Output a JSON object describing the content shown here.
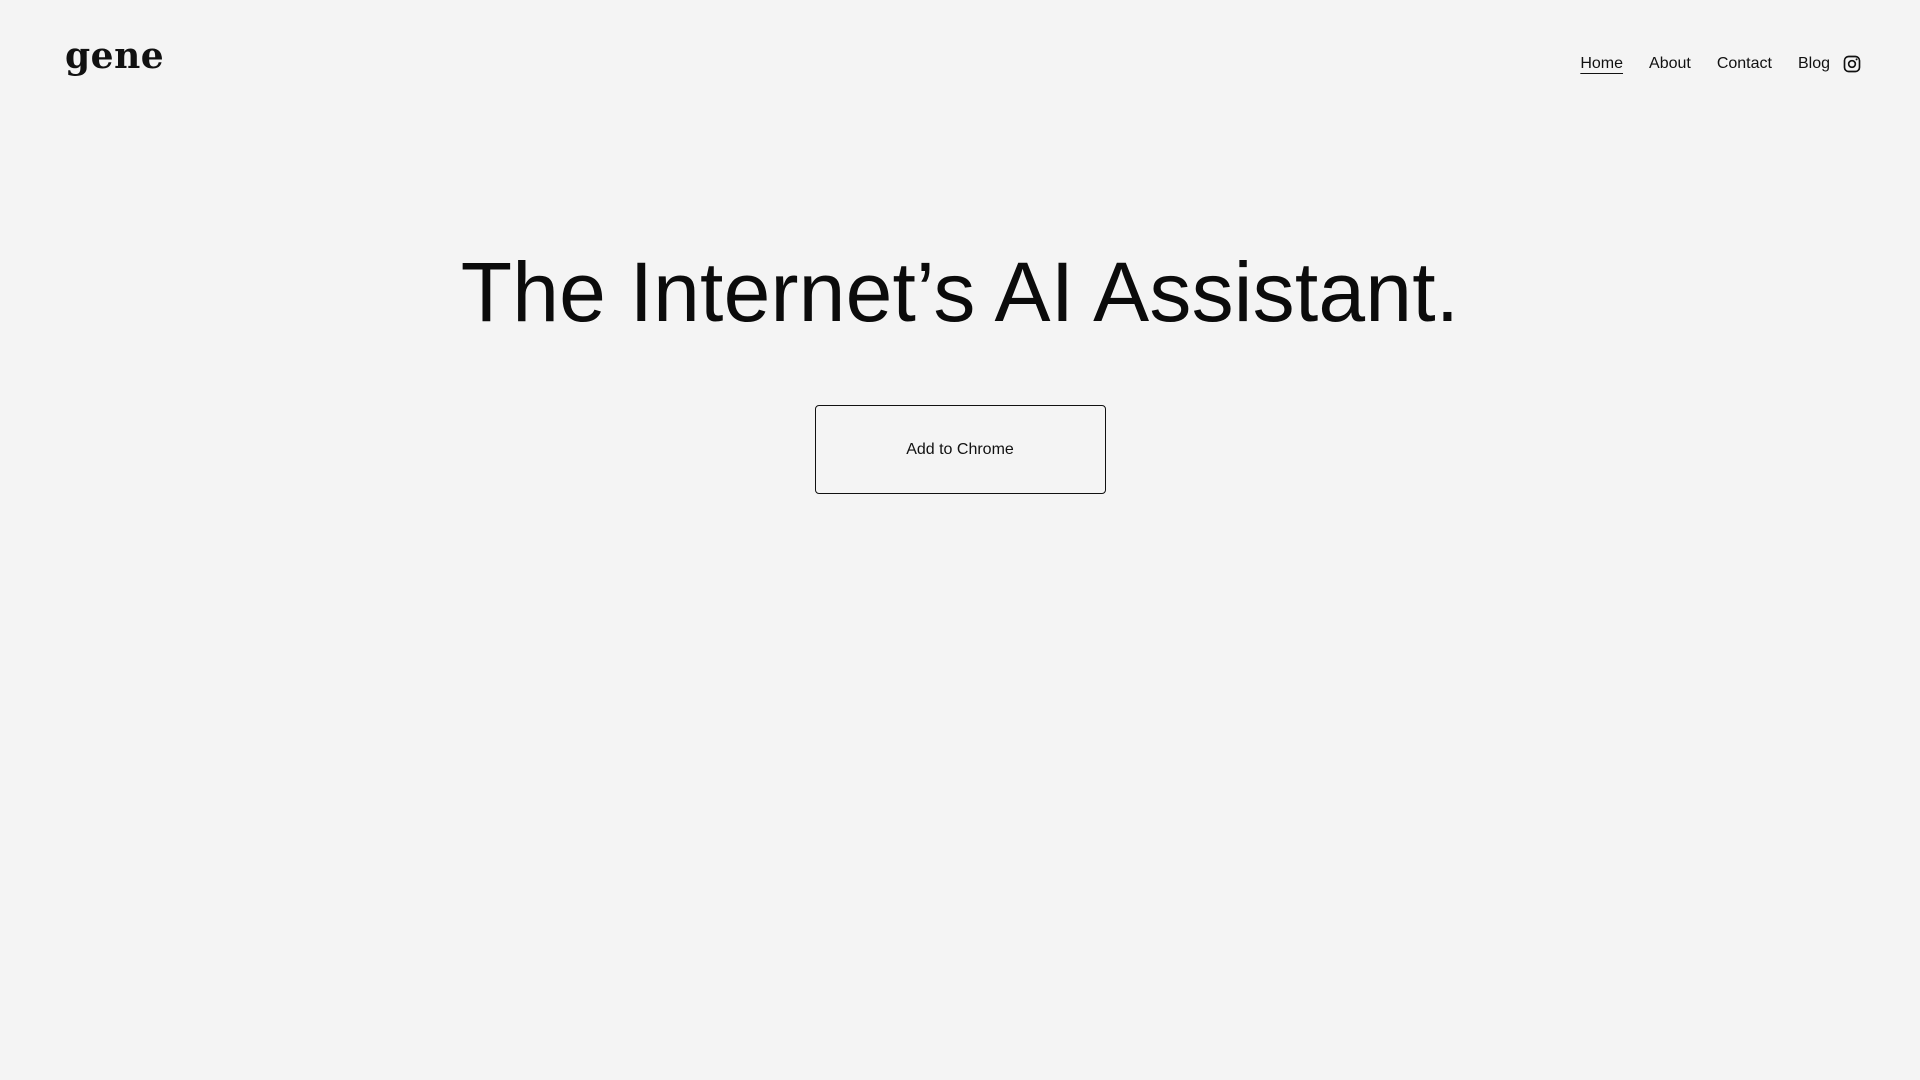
{
  "site": {
    "logo_text": "gene"
  },
  "nav": {
    "items": [
      {
        "label": "Home"
      },
      {
        "label": "About"
      },
      {
        "label": "Contact"
      },
      {
        "label": "Blog"
      }
    ],
    "social_icon": "instagram-icon"
  },
  "hero": {
    "title": "The Internet’s AI Assistant.",
    "cta_label": "Add to Chrome"
  },
  "colors": {
    "background": "#f4f4f4",
    "text": "#0b0b0b"
  }
}
